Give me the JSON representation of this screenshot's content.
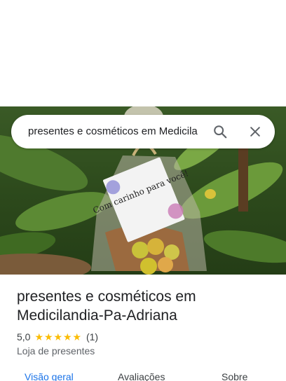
{
  "search": {
    "query": "presentes e cosméticos em Medicila",
    "search_icon": "search-icon",
    "close_icon": "close-icon"
  },
  "hero": {
    "tag_text": "Com carinho para você!"
  },
  "place": {
    "title": "presentes e cosméticos em Medicilandia-Pa-Adriana",
    "rating": "5,0",
    "stars": 5,
    "review_count": "(1)",
    "category": "Loja de presentes"
  },
  "tabs": [
    {
      "label": "Visão geral",
      "active": true
    },
    {
      "label": "Avaliações",
      "active": false
    },
    {
      "label": "Sobre",
      "active": false
    }
  ],
  "colors": {
    "accent": "#1a73e8",
    "star": "#fbbc04"
  }
}
